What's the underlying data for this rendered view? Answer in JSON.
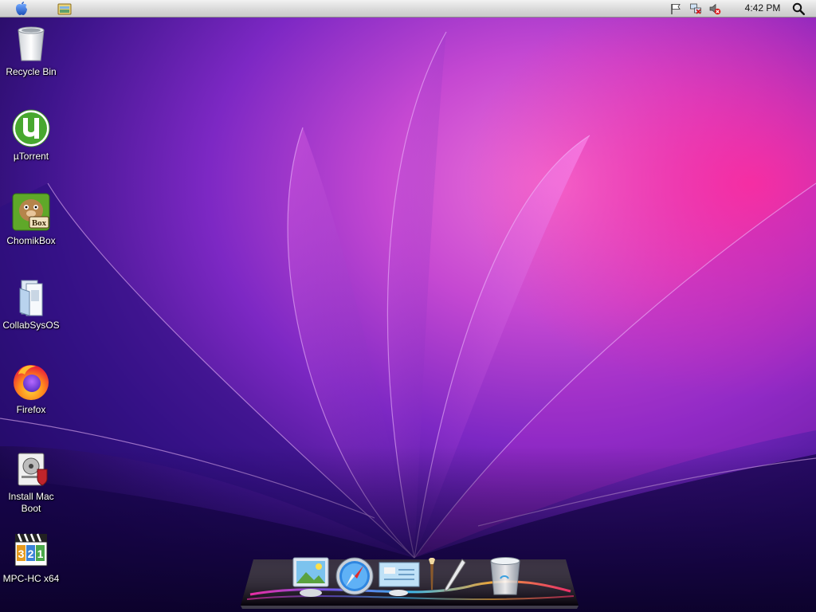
{
  "menubar": {
    "apple_icon": "apple-icon",
    "finder_icon": "finder-icon",
    "tray_icons": [
      "flag-icon",
      "network-icon",
      "volume-muted-icon"
    ],
    "clock": "4:42 PM",
    "search_icon": "spotlight-search-icon"
  },
  "desktop": {
    "icons": [
      {
        "label": "Recycle Bin",
        "icon": "recycle-bin-icon"
      },
      {
        "label": "µTorrent",
        "icon": "utorrent-icon"
      },
      {
        "label": "ChomikBox",
        "icon": "chomikbox-icon"
      },
      {
        "label": "CollabSysOS",
        "icon": "folder-document-icon"
      },
      {
        "label": "Firefox",
        "icon": "firefox-icon"
      },
      {
        "label": "Install Mac Boot",
        "icon": "installer-icon"
      },
      {
        "label": "MPC-HC x64",
        "icon": "mpc-hc-icon"
      }
    ]
  },
  "dock": {
    "items": [
      "photo-viewer-icon",
      "safari-icon",
      "preview-icon",
      "brush-pen-icon",
      "trash-icon"
    ]
  },
  "colors": {
    "wallpaper_dark": "#1d0a5a",
    "wallpaper_purple": "#8e2fd6",
    "wallpaper_pink": "#e63ab4",
    "label_text": "#ffffff"
  }
}
